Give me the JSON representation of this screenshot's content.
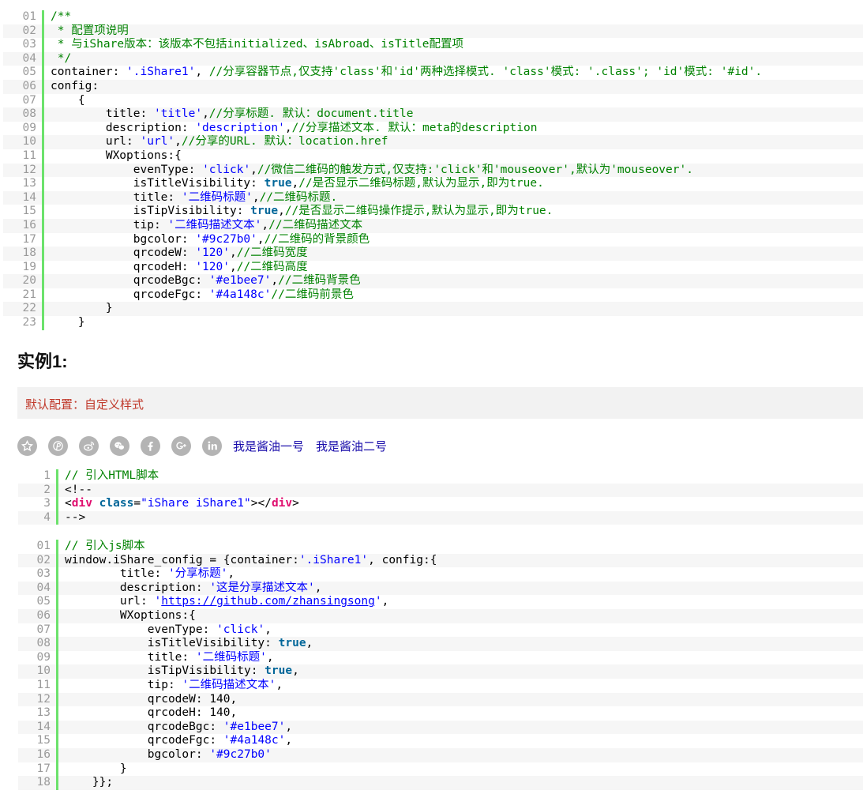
{
  "config_code": {
    "lines": [
      {
        "num": "01",
        "parts": [
          {
            "t": "/**",
            "c": "c"
          }
        ]
      },
      {
        "num": "02",
        "parts": [
          {
            "t": " * 配置项说明",
            "c": "c"
          }
        ]
      },
      {
        "num": "03",
        "parts": [
          {
            "t": " * 与iShare版本：该版本不包括initialized、isAbroad、isTitle配置项",
            "c": "c"
          }
        ]
      },
      {
        "num": "04",
        "parts": [
          {
            "t": " */",
            "c": "c"
          }
        ]
      },
      {
        "num": "05",
        "parts": [
          {
            "t": "container: "
          },
          {
            "t": "'.iShare1'",
            "c": "s"
          },
          {
            "t": ", "
          },
          {
            "t": "//分享容器节点,仅支持'class'和'id'两种选择模式. 'class'模式: '.class'; 'id'模式: '#id'.",
            "c": "c"
          }
        ]
      },
      {
        "num": "06",
        "parts": [
          {
            "t": "config:"
          }
        ]
      },
      {
        "num": "07",
        "parts": [
          {
            "t": "    {"
          }
        ]
      },
      {
        "num": "08",
        "parts": [
          {
            "t": "        title: "
          },
          {
            "t": "'title'",
            "c": "s"
          },
          {
            "t": ","
          },
          {
            "t": "//分享标题. 默认：document.title",
            "c": "c"
          }
        ]
      },
      {
        "num": "09",
        "parts": [
          {
            "t": "        description: "
          },
          {
            "t": "'description'",
            "c": "s"
          },
          {
            "t": ","
          },
          {
            "t": "//分享描述文本. 默认：meta的description",
            "c": "c"
          }
        ]
      },
      {
        "num": "10",
        "parts": [
          {
            "t": "        url: "
          },
          {
            "t": "'url'",
            "c": "s"
          },
          {
            "t": ","
          },
          {
            "t": "//分享的URL. 默认：location.href",
            "c": "c"
          }
        ]
      },
      {
        "num": "11",
        "parts": [
          {
            "t": "        WXoptions:{"
          }
        ]
      },
      {
        "num": "12",
        "parts": [
          {
            "t": "            evenType: "
          },
          {
            "t": "'click'",
            "c": "s"
          },
          {
            "t": ","
          },
          {
            "t": "//微信二维码的触发方式,仅支持:'click'和'mouseover',默认为'mouseover'.",
            "c": "c"
          }
        ]
      },
      {
        "num": "13",
        "parts": [
          {
            "t": "            isTitleVisibility: "
          },
          {
            "t": "true",
            "c": "k"
          },
          {
            "t": ","
          },
          {
            "t": "//是否显示二维码标题,默认为显示,即为true.",
            "c": "c"
          }
        ]
      },
      {
        "num": "14",
        "parts": [
          {
            "t": "            title: "
          },
          {
            "t": "'二维码标题'",
            "c": "s"
          },
          {
            "t": ","
          },
          {
            "t": "//二维码标题.",
            "c": "c"
          }
        ]
      },
      {
        "num": "15",
        "parts": [
          {
            "t": "            isTipVisibility: "
          },
          {
            "t": "true",
            "c": "k"
          },
          {
            "t": ","
          },
          {
            "t": "//是否显示二维码操作提示,默认为显示,即为true.",
            "c": "c"
          }
        ]
      },
      {
        "num": "16",
        "parts": [
          {
            "t": "            tip: "
          },
          {
            "t": "'二维码描述文本'",
            "c": "s"
          },
          {
            "t": ","
          },
          {
            "t": "//二维码描述文本",
            "c": "c"
          }
        ]
      },
      {
        "num": "17",
        "parts": [
          {
            "t": "            bgcolor: "
          },
          {
            "t": "'#9c27b0'",
            "c": "s"
          },
          {
            "t": ","
          },
          {
            "t": "//二维码的背景颜色",
            "c": "c"
          }
        ]
      },
      {
        "num": "18",
        "parts": [
          {
            "t": "            qrcodeW: "
          },
          {
            "t": "'120'",
            "c": "s"
          },
          {
            "t": ","
          },
          {
            "t": "//二维码宽度",
            "c": "c"
          }
        ]
      },
      {
        "num": "19",
        "parts": [
          {
            "t": "            qrcodeH: "
          },
          {
            "t": "'120'",
            "c": "s"
          },
          {
            "t": ","
          },
          {
            "t": "//二维码高度",
            "c": "c"
          }
        ]
      },
      {
        "num": "20",
        "parts": [
          {
            "t": "            qrcodeBgc: "
          },
          {
            "t": "'#e1bee7'",
            "c": "s"
          },
          {
            "t": ","
          },
          {
            "t": "//二维码背景色",
            "c": "c"
          }
        ]
      },
      {
        "num": "21",
        "parts": [
          {
            "t": "            qrcodeFgc: "
          },
          {
            "t": "'#4a148c'",
            "c": "s"
          },
          {
            "t": "//二维码前景色",
            "c": "c"
          }
        ]
      },
      {
        "num": "22",
        "parts": [
          {
            "t": "        }"
          }
        ]
      },
      {
        "num": "23",
        "parts": [
          {
            "t": "    }"
          }
        ]
      }
    ]
  },
  "example": {
    "heading": "实例1:",
    "note": "默认配置：自定义样式",
    "share_icons": [
      "star-icon",
      "pinterest-icon",
      "weibo-icon",
      "wechat-icon",
      "facebook-icon",
      "google-plus-icon",
      "linkedin-icon"
    ],
    "share_links": [
      "我是酱油一号",
      "我是酱油二号"
    ]
  },
  "html_code": {
    "lines": [
      {
        "num": "1",
        "parts": [
          {
            "t": "// 引入HTML脚本",
            "c": "c"
          }
        ]
      },
      {
        "num": "2",
        "parts": [
          {
            "t": "<!--"
          }
        ]
      },
      {
        "num": "3",
        "parts": [
          {
            "t": "<"
          },
          {
            "t": "div",
            "c": "tag"
          },
          {
            "t": " "
          },
          {
            "t": "class",
            "c": "attr"
          },
          {
            "t": "="
          },
          {
            "t": "\"iShare iShare1\"",
            "c": "s"
          },
          {
            "t": "></"
          },
          {
            "t": "div",
            "c": "tag"
          },
          {
            "t": ">"
          }
        ]
      },
      {
        "num": "4",
        "parts": [
          {
            "t": "-->"
          }
        ]
      }
    ]
  },
  "js_code": {
    "lines": [
      {
        "num": "01",
        "parts": [
          {
            "t": "// 引入js脚本",
            "c": "c"
          }
        ]
      },
      {
        "num": "02",
        "parts": [
          {
            "t": "window.iShare_config = {container:"
          },
          {
            "t": "'.iShare1'",
            "c": "s"
          },
          {
            "t": ", config:{"
          }
        ]
      },
      {
        "num": "03",
        "parts": [
          {
            "t": "        title: "
          },
          {
            "t": "'分享标题'",
            "c": "s"
          },
          {
            "t": ","
          }
        ]
      },
      {
        "num": "04",
        "parts": [
          {
            "t": "        description: "
          },
          {
            "t": "'这是分享描述文本'",
            "c": "s"
          },
          {
            "t": ","
          }
        ]
      },
      {
        "num": "05",
        "parts": [
          {
            "t": "        url: "
          },
          {
            "t": "'",
            "c": "s"
          },
          {
            "t": "https://github.com/zhansingsong",
            "c": "s u"
          },
          {
            "t": "'",
            "c": "s"
          },
          {
            "t": ","
          }
        ]
      },
      {
        "num": "06",
        "parts": [
          {
            "t": "        WXoptions:{"
          }
        ]
      },
      {
        "num": "07",
        "parts": [
          {
            "t": "            evenType: "
          },
          {
            "t": "'click'",
            "c": "s"
          },
          {
            "t": ","
          }
        ]
      },
      {
        "num": "08",
        "parts": [
          {
            "t": "            isTitleVisibility: "
          },
          {
            "t": "true",
            "c": "k"
          },
          {
            "t": ","
          }
        ]
      },
      {
        "num": "09",
        "parts": [
          {
            "t": "            title: "
          },
          {
            "t": "'二维码标题'",
            "c": "s"
          },
          {
            "t": ","
          }
        ]
      },
      {
        "num": "10",
        "parts": [
          {
            "t": "            isTipVisibility: "
          },
          {
            "t": "true",
            "c": "k"
          },
          {
            "t": ","
          }
        ]
      },
      {
        "num": "11",
        "parts": [
          {
            "t": "            tip: "
          },
          {
            "t": "'二维码描述文本'",
            "c": "s"
          },
          {
            "t": ","
          }
        ]
      },
      {
        "num": "12",
        "parts": [
          {
            "t": "            qrcodeW: 140,"
          }
        ]
      },
      {
        "num": "13",
        "parts": [
          {
            "t": "            qrcodeH: 140,"
          }
        ]
      },
      {
        "num": "14",
        "parts": [
          {
            "t": "            qrcodeBgc: "
          },
          {
            "t": "'#e1bee7'",
            "c": "s"
          },
          {
            "t": ","
          }
        ]
      },
      {
        "num": "15",
        "parts": [
          {
            "t": "            qrcodeFgc: "
          },
          {
            "t": "'#4a148c'",
            "c": "s"
          },
          {
            "t": ","
          }
        ]
      },
      {
        "num": "16",
        "parts": [
          {
            "t": "            bgcolor: "
          },
          {
            "t": "'#9c27b0'",
            "c": "s"
          }
        ]
      },
      {
        "num": "17",
        "parts": [
          {
            "t": "        }"
          }
        ]
      },
      {
        "num": "18",
        "parts": [
          {
            "t": "    }};"
          }
        ]
      }
    ]
  }
}
